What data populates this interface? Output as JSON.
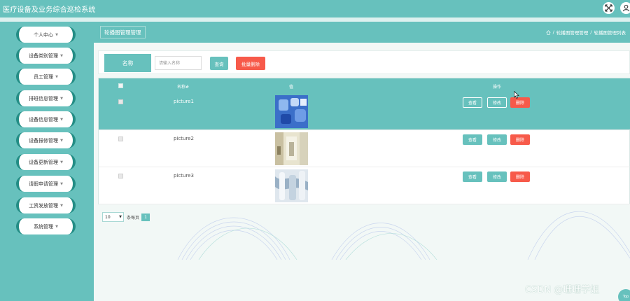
{
  "app": {
    "title": "医疗设备及业务综合巡检系统"
  },
  "sidebar": {
    "items": [
      {
        "label": "个人中心"
      },
      {
        "label": "设备类别管理"
      },
      {
        "label": "员工管理"
      },
      {
        "label": "排班信息管理"
      },
      {
        "label": "设备信息管理"
      },
      {
        "label": "设备报修管理"
      },
      {
        "label": "设备更新管理"
      },
      {
        "label": "请假申请管理"
      },
      {
        "label": "工资发放管理"
      },
      {
        "label": "系统管理"
      }
    ]
  },
  "breadcrumb": {
    "page_button": "轮播图管理管理",
    "items": [
      "轮播图管理管理",
      "轮播图管理列表"
    ],
    "sep": "/"
  },
  "search": {
    "label": "名称",
    "placeholder": "请输入名称",
    "query_btn": "查询",
    "batch_delete_btn": "批量删除"
  },
  "table": {
    "headers": {
      "name": "名称#",
      "value": "值",
      "actions": "操作"
    },
    "rows": [
      {
        "name": "picture1",
        "active": true
      },
      {
        "name": "picture2",
        "active": false
      },
      {
        "name": "picture3",
        "active": false
      }
    ],
    "row_actions": {
      "view": "查看",
      "edit": "修改",
      "delete": "删除"
    }
  },
  "pagination": {
    "page_size": "10",
    "per_page_label": "条每页",
    "current_page": "1"
  },
  "watermark": "CSDN @珊珊学姐",
  "back_to_top": "Top",
  "colors": {
    "primary": "#67c1bd",
    "danger": "#f75a4a",
    "sidebar_edge": "#238d85"
  }
}
